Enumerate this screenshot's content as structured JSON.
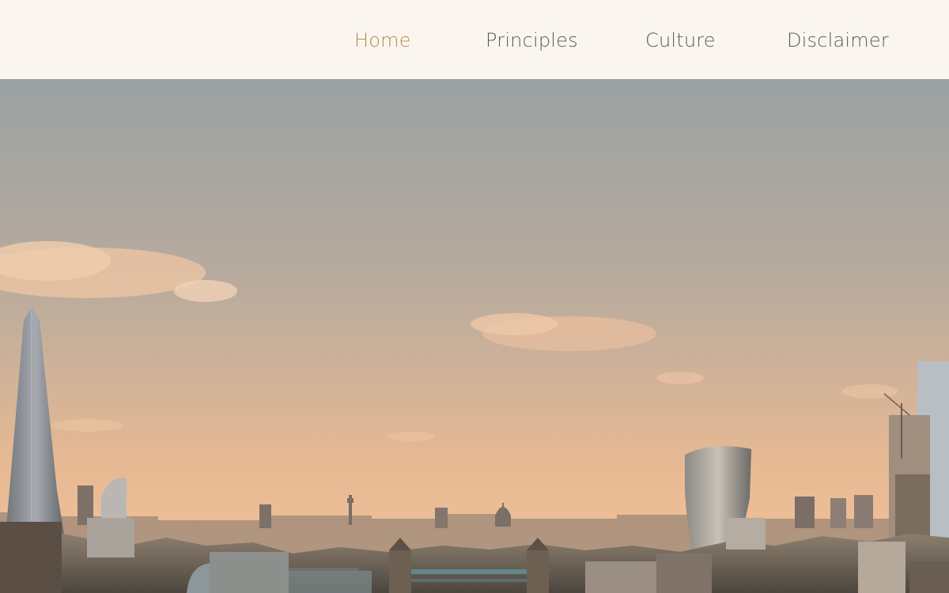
{
  "nav": {
    "items": [
      {
        "label": "Home",
        "active": true
      },
      {
        "label": "Principles",
        "active": false
      },
      {
        "label": "Culture",
        "active": false
      },
      {
        "label": "Disclaimer",
        "active": false
      }
    ]
  },
  "hero": {
    "image": "london-skyline-sunset",
    "colors": {
      "sky_top": "#9aa1a2",
      "sky_mid": "#c3ad9c",
      "sky_bottom": "#f0bf95",
      "accent": "#b98a4e"
    }
  }
}
